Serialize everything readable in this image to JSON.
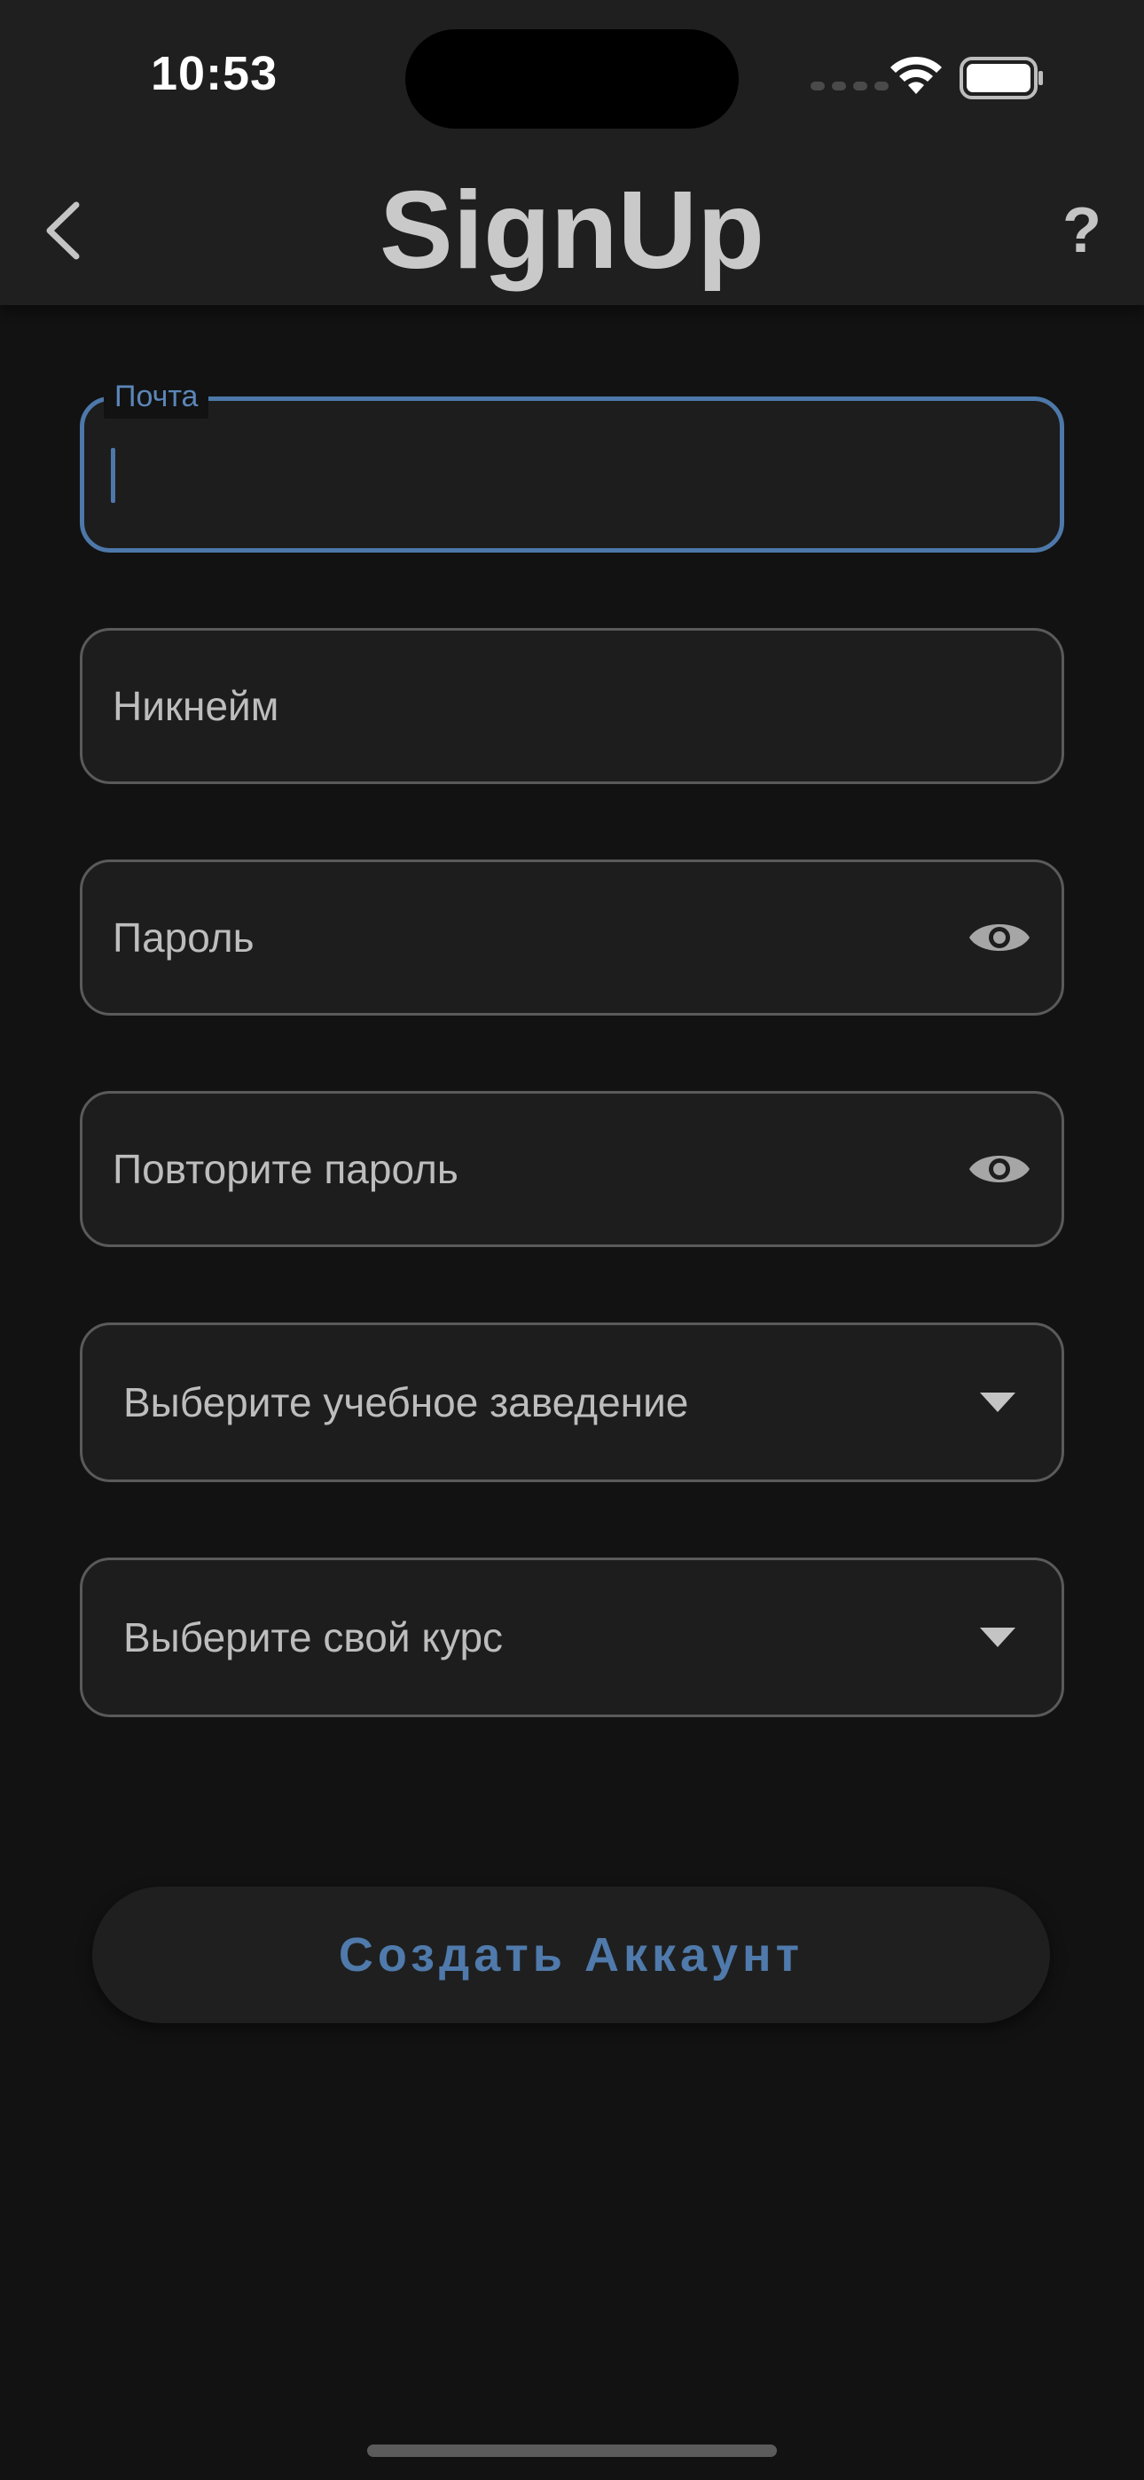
{
  "status_bar": {
    "time": "10:53"
  },
  "header": {
    "title": "SignUp",
    "help_label": "?"
  },
  "form": {
    "email": {
      "label": "Почта",
      "value": ""
    },
    "nickname": {
      "placeholder": "Никнейм"
    },
    "password": {
      "placeholder": "Пароль"
    },
    "repeat_password": {
      "placeholder": "Повторите пароль"
    },
    "institution": {
      "placeholder": "Выберите учебное заведение"
    },
    "course": {
      "placeholder": "Выберите свой курс"
    }
  },
  "create_button": {
    "label": "Создать Аккаунт"
  },
  "colors": {
    "background": "#121212",
    "surface": "#1f1f1f",
    "accent": "#4d78a9",
    "text": "#c4c4c4"
  }
}
